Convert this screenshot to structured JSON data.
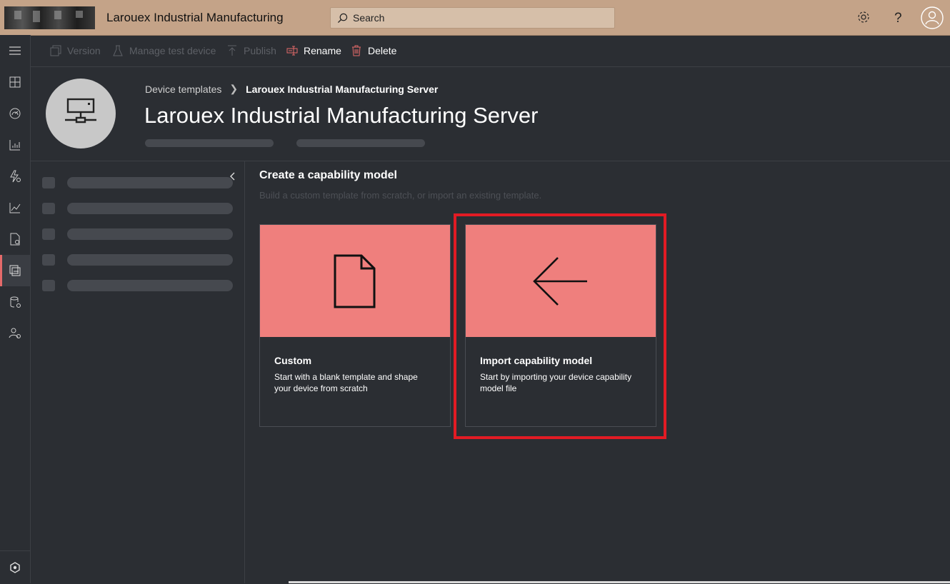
{
  "app": {
    "title": "Larouex Industrial Manufacturing"
  },
  "search": {
    "placeholder": "Search"
  },
  "toolbar": {
    "version": "Version",
    "manage_test_device": "Manage test device",
    "publish": "Publish",
    "rename": "Rename",
    "delete": "Delete"
  },
  "breadcrumb": {
    "parent": "Device templates",
    "current": "Larouex Industrial Manufacturing Server"
  },
  "page": {
    "title": "Larouex Industrial Manufacturing Server"
  },
  "section": {
    "title": "Create a capability model",
    "subtitle": "Build a custom template from scratch, or import an existing template."
  },
  "cards": [
    {
      "title": "Custom",
      "description": "Start with a blank template and shape your device from scratch",
      "icon": "document-icon"
    },
    {
      "title": "Import capability model",
      "description": "Start by importing your device capability model file",
      "icon": "arrow-left-icon"
    }
  ],
  "colors": {
    "topbar": "#c4a388",
    "background": "#2b2e33",
    "card_accent": "#ef7f7d",
    "highlight": "#e21b24",
    "delete_icon": "#e46a6a"
  },
  "rail_icons": [
    "hamburger-icon",
    "dashboard-icon",
    "devices-icon",
    "analytics-icon",
    "rules-icon",
    "chart-icon",
    "jobs-icon",
    "device-templates-icon",
    "data-export-icon",
    "administration-icon",
    "iot-central-icon"
  ]
}
